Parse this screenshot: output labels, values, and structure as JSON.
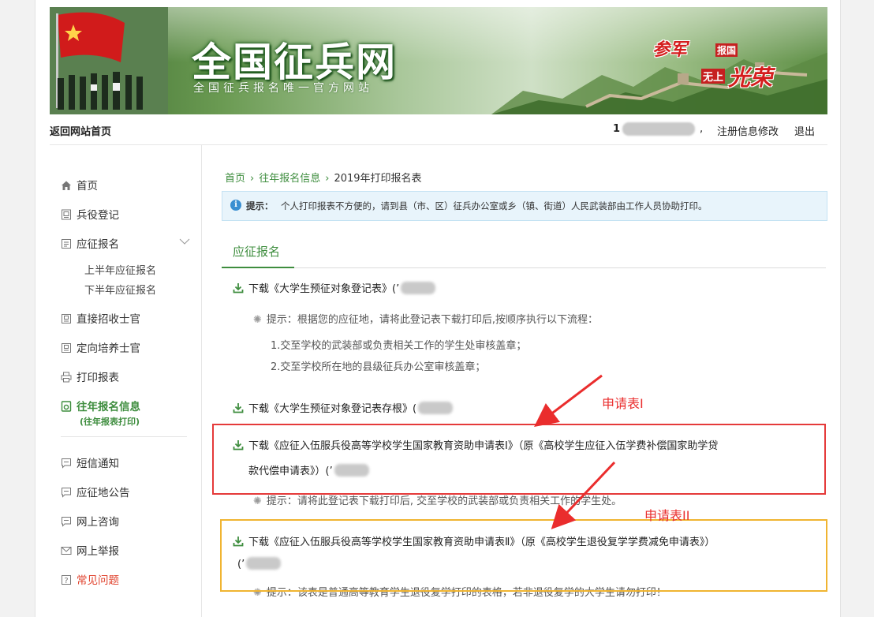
{
  "banner": {
    "title": "全国征兵网",
    "subtitle": "全国征兵报名唯一官方网站",
    "slogan_a": "参军",
    "slogan_b": "报国",
    "slogan_c": "无上",
    "slogan_d": "光荣"
  },
  "topbar": {
    "home_link": "返回网站首页",
    "user_prefix": "1",
    "separator": ",",
    "modify_link": "注册信息修改",
    "logout_link": "退出"
  },
  "sidebar": {
    "items": [
      {
        "label": "首页",
        "icon": "home-icon"
      },
      {
        "label": "兵役登记",
        "icon": "id-card-icon"
      },
      {
        "label": "应征报名",
        "icon": "form-icon"
      },
      {
        "label": "直接招收士官",
        "icon": "id-badge-icon"
      },
      {
        "label": "定向培养士官",
        "icon": "id-badge-icon"
      },
      {
        "label": "打印报表",
        "icon": "printer-icon"
      },
      {
        "label": "往年报名信息",
        "icon": "refresh-doc-icon"
      },
      {
        "label": "短信通知",
        "icon": "message-icon"
      },
      {
        "label": "应征地公告",
        "icon": "message-icon"
      },
      {
        "label": "网上咨询",
        "icon": "message-icon"
      },
      {
        "label": "网上举报",
        "icon": "mail-icon"
      },
      {
        "label": "常见问题",
        "icon": "question-icon"
      }
    ],
    "sub_items": [
      "上半年应征报名",
      "下半年应征报名"
    ],
    "active_note": "(往年报表打印)"
  },
  "main": {
    "breadcrumb": {
      "home": "首页",
      "prev": "往年报名信息",
      "current": "2019年打印报名表",
      "arrow": "›"
    },
    "tip": {
      "label": "提示：",
      "text": "个人打印报表不方便的，请到县（市、区）征兵办公室或乡（镇、街道）人民武装部由工作人员协助打印。"
    },
    "section_title": "应征报名",
    "downloads": [
      {
        "text": "下载《大学生预征对象登记表》(’"
      },
      {
        "text": "下载《大学生预征对象登记表存根》("
      },
      {
        "line1": "下载《应征入伍服兵役高等学校学生国家教育资助申请表Ⅰ》（原《高校学生应征入伍学费补偿国家助学贷",
        "line2": "款代偿申请表》）(’"
      },
      {
        "line1": "下载《应征入伍服兵役高等学校学生国家教育资助申请表Ⅱ》（原《高校学生退役复学学费减免申请表》）",
        "line2": "(’"
      }
    ],
    "hints": [
      "提示：根据您的应征地，请将此登记表下载打印后,按顺序执行以下流程：",
      "提示：请将此登记表下载打印后, 交至学校的武装部或负责相关工作的学生处。",
      "提示：该表是普通高等教育学生退役复学打印的表格，若非退役复学的大学生请勿打印！"
    ],
    "steps": [
      "1.交至学校的武装部或负责相关工作的学生处审核盖章；",
      "2.交至学校所在地的县级征兵办公室审核盖章；"
    ]
  },
  "annotations": {
    "label1": "申请表I",
    "label2": "申请表II",
    "color_red": "#e53a3a",
    "color_yellow": "#f0b431"
  },
  "colors": {
    "accent": "#3e8d3e",
    "tip_bg": "#e8f4fb"
  }
}
